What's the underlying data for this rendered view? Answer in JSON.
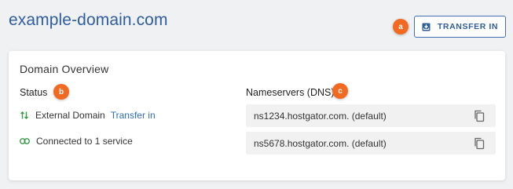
{
  "header": {
    "domain_name": "example-domain.com",
    "transfer_button_label": "TRANSFER IN"
  },
  "badges": {
    "a": "a",
    "b": "b",
    "c": "c"
  },
  "overview": {
    "title": "Domain Overview",
    "status_label": "Status",
    "nameservers_label": "Nameservers (DNS)",
    "status_items": [
      {
        "icon": "transfer-arrows-icon",
        "text": "External Domain",
        "link": "Transfer in"
      },
      {
        "icon": "link-icon",
        "text": "Connected to 1 service"
      }
    ],
    "nameservers": [
      "ns1234.hostgator.com. (default)",
      "ns5678.hostgator.com. (default)"
    ]
  },
  "colors": {
    "accent": "#2f5d9e",
    "badge": "#f26a21",
    "status_icon": "#3a9a4a"
  }
}
